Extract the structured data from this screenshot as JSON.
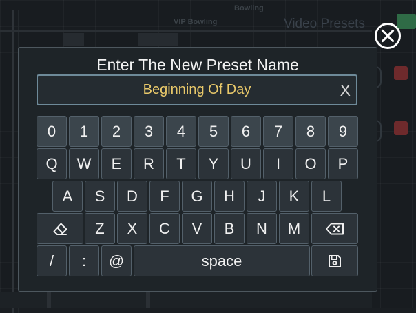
{
  "background": {
    "app_title": "Video Presets",
    "label_top": "Bowling",
    "label_vip": "VIP Bowling"
  },
  "dialog": {
    "title": "Enter The New Preset Name",
    "input_value": "Beginning Of Day",
    "clear_label": "X",
    "value_color": "#e8c86a"
  },
  "keyboard": {
    "row_numbers": [
      "0",
      "1",
      "2",
      "3",
      "4",
      "5",
      "6",
      "7",
      "8",
      "9"
    ],
    "row_q": [
      "Q",
      "W",
      "E",
      "R",
      "T",
      "Y",
      "U",
      "I",
      "O",
      "P"
    ],
    "row_a": [
      "A",
      "S",
      "D",
      "F",
      "G",
      "H",
      "J",
      "K",
      "L"
    ],
    "row_z": [
      "Z",
      "X",
      "C",
      "V",
      "B",
      "N",
      "M"
    ],
    "slash": "/",
    "colon": ":",
    "at": "@",
    "space": "space",
    "icons": {
      "clear": "eraser-icon",
      "backspace": "backspace-icon",
      "save": "save-icon",
      "close": "close-circle-icon"
    }
  }
}
